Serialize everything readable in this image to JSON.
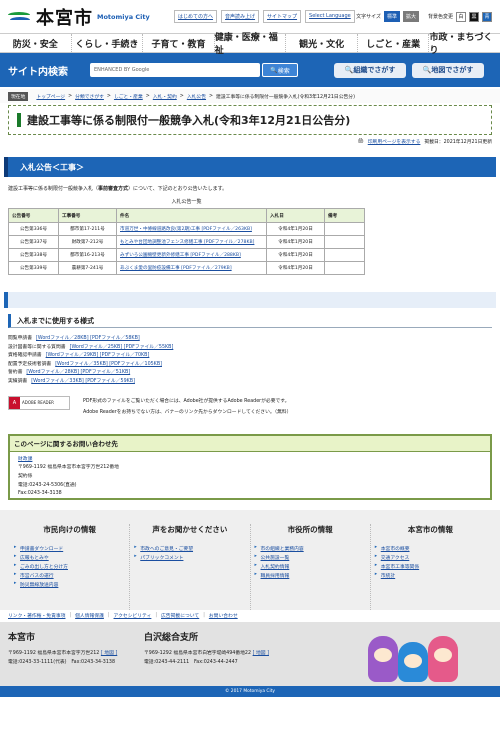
{
  "header": {
    "logo_name": "本宮市",
    "logo_sub": "Motomiya City",
    "links": [
      "はじめての方へ",
      "音声読み上げ",
      "サイトマップ",
      "Select Language"
    ],
    "font_size_label": "文字サイズ",
    "font_std": "標準",
    "font_large": "拡大",
    "bg_label": "背景色変更",
    "bg_white": "白",
    "bg_black": "黒",
    "bg_blue": "青"
  },
  "nav": [
    "防災・安全",
    "くらし・手続き",
    "子育て・教育",
    "健康・医療・福祉",
    "観光・文化",
    "しごと・産業",
    "市政・まちづくり"
  ],
  "search": {
    "title": "サイト内検索",
    "placeholder": "ENHANCED BY Google",
    "button": "検索",
    "org_button": "組織でさがす",
    "map_button": "地図でさがす"
  },
  "breadcrumb": {
    "here": "現在地",
    "items": [
      "トップページ",
      "分類でさがす",
      "しごと・産業",
      "入札・契約",
      "入札公告",
      "建設工事等に係る制限付一般競争入札(令和3年12月21日公告分)"
    ]
  },
  "page_title": "建設工事等に係る制限付一般競争入札(令和3年12月21日公告分)",
  "print": {
    "link": "印刷用ページを表示する",
    "date": "掲載日：2021年12月21日更新"
  },
  "section1": "入札公告＜工事＞",
  "intro_pre": "建設工事等に係る制限付一般競争入札（",
  "intro_bold": "事前審査方式",
  "intro_post": "）について、下記のとおり公告いたします。",
  "table_caption": "入札公告一覧",
  "table": {
    "headers": [
      "公告番号",
      "工事番号",
      "件名",
      "入札日",
      "備考"
    ],
    "rows": [
      [
        "公告第336号",
        "都市第17-211号",
        "市道万世・中條線道路改良(第2期)工事 [PDFファイル／263KB]",
        "令和4年1月20日",
        ""
      ],
      [
        "公告第337号",
        "財政第7-212号",
        "もとみや台団地調整池フェンス修繕工事 [PDFファイル／278KB]",
        "令和4年1月20日",
        ""
      ],
      [
        "公告第338号",
        "都市第16-213号",
        "みずいろ公園擁壁更新外修繕工事 [PDFファイル／288KB]",
        "令和4年1月20日",
        ""
      ],
      [
        "公告第339号",
        "農耕第7-241号",
        "あぶくま愛の里防疫設備工事 [PDFファイル／279KB]",
        "令和4年1月20日",
        ""
      ]
    ]
  },
  "section2": "入札までに使用する様式",
  "forms": [
    {
      "label": "閲覧申請書",
      "links": "[Wordファイル／28KB] [PDFファイル／58KB]"
    },
    {
      "label": "設計図書等に関する質問書",
      "links": "[Wordファイル／25KB] [PDFファイル／55KB]"
    },
    {
      "label": "資格確認申請書",
      "links": "[Wordファイル／29KB] [PDFファイル／70KB]"
    },
    {
      "label": "配置予定技術者調書",
      "links": "[Wordファイル／35KB] [PDFファイル／105KB]"
    },
    {
      "label": "誓約書",
      "links": "[Wordファイル／28KB] [PDFファイル／51KB]"
    },
    {
      "label": "実績調書",
      "links": "[Wordファイル／33KB] [PDFファイル／59KB]"
    }
  ],
  "adobe": {
    "badge": "ADOBE READER",
    "line1": "PDF形式のファイルをご覧いただく場合には、Adobe社が提供するAdobe Readerが必要です。",
    "line2": "Adobe Readerをお持ちでない方は、バナーのリンク先からダウンロードしてください。（無料）"
  },
  "contact": {
    "title": "このページに関するお問い合わせ先",
    "dept": "財政課",
    "address": "〒969-1192 福島県本宮市本宮字万世212番地",
    "office": "契約係",
    "tel": "電話:0243-24-5306(直通)",
    "fax": "Fax:0243-34-3138"
  },
  "footer_nav": [
    {
      "title": "市民向けの情報",
      "items": [
        "申請書ダウンロード",
        "広報もとみや",
        "ごみの出し方と分け方",
        "市営バスの運行",
        "防災無線放送内容"
      ]
    },
    {
      "title": "声をお聞かせください",
      "items": [
        "市政へのご意見・ご要望",
        "パブリックコメント"
      ]
    },
    {
      "title": "市役所の情報",
      "items": [
        "市の組織と業務内容",
        "公共施設一覧",
        "入札契約情報",
        "職員採用情報"
      ]
    },
    {
      "title": "本宮市の情報",
      "items": [
        "本宮市の概要",
        "交通アクセス",
        "本宮市工事等関係",
        "市統計"
      ]
    }
  ],
  "footer_bar": [
    "リンク・著作権・免責事項",
    "個人情報保護",
    "アクセシビリティ",
    "広告掲載について",
    "お問い合わせ"
  ],
  "footer_info": {
    "city": "本宮市",
    "city_addr": "〒969-1192 福島県本宮市本宮字万世212",
    "city_map": "[ 地図 ]",
    "city_tel": "電話:0243-33-1111(代表)　Fax:0243-34-3138",
    "branch": "白沢総合支所",
    "branch_addr": "〒969-1292 福島県本宮市白岩字堤崎494番地22",
    "branch_map": "[ 地図 ]",
    "branch_tel": "電話:0243-44-2111　Fax:0243-44-2447"
  },
  "copyright": "© 2017 Motomiya City"
}
